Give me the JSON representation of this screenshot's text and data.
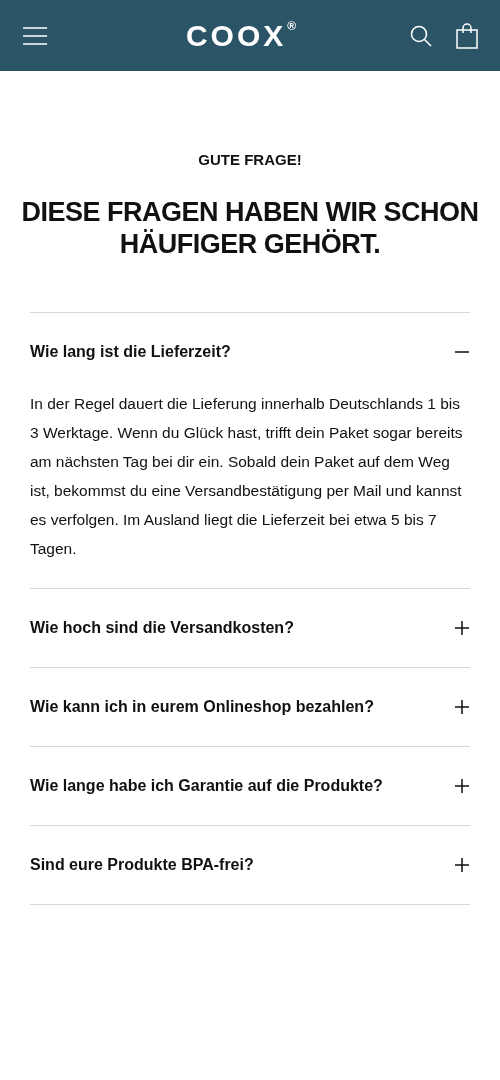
{
  "header": {
    "logo": "COOX",
    "logo_mark": "®"
  },
  "section": {
    "eyebrow": "GUTE FRAGE!",
    "title": "DIESE FRAGEN HABEN WIR SCHON HÄUFIGER GEHÖRT."
  },
  "faq": [
    {
      "question": "Wie lang ist die Lieferzeit?",
      "expanded": true,
      "answer": "In der Regel dauert die Lieferung innerhalb Deutschlands 1 bis 3 Werktage. Wenn du Glück hast, trifft dein Paket sogar bereits am nächsten Tag bei dir ein. Sobald dein Paket auf dem Weg ist, bekommst du eine Versandbestätigung per Mail und kannst es verfolgen. Im Ausland liegt die Lieferzeit bei etwa 5 bis 7 Tagen."
    },
    {
      "question": "Wie hoch sind die Versandkosten?",
      "expanded": false
    },
    {
      "question": "Wie kann ich in eurem Onlineshop bezahlen?",
      "expanded": false
    },
    {
      "question": "Wie lange habe ich Garantie auf die Produkte?",
      "expanded": false
    },
    {
      "question": "Sind eure Produkte BPA-frei?",
      "expanded": false
    }
  ]
}
